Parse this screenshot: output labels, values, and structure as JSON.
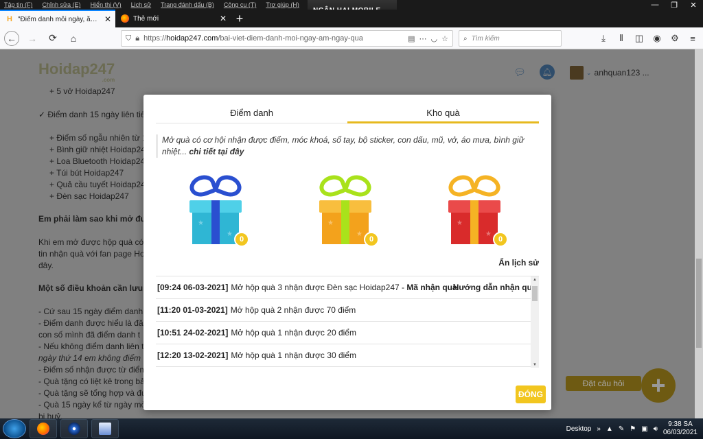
{
  "window": {
    "menus": [
      "Tập tin (F)",
      "Chỉnh sửa (E)",
      "Hiển thị (V)",
      "Lịch sử",
      "Trang đánh dấu (B)",
      "Công cụ (T)",
      "Trợ giúp (H)"
    ],
    "ad_text": "NGÂN HAI MOBILE",
    "minimize": "—",
    "restore": "❐",
    "close": "✕"
  },
  "tabs": [
    {
      "title": "\"Điểm danh mỗi ngày, ẵm ngày quà\"",
      "favicon": "H",
      "close": "✕"
    },
    {
      "title": "Thẻ mới",
      "close": "✕"
    }
  ],
  "new_tab": "+",
  "nav": {
    "url_prefix": "https://",
    "url_domain": "hoidap247.com",
    "url_path": "/bai-viet-diem-danh-moi-ngay-am-ngay-qua",
    "search_placeholder": "Tìm kiếm"
  },
  "site": {
    "logo": "Hoidap247",
    "logo_domain": ".com",
    "username": "anhquan123 ..."
  },
  "article": [
    "+ 5 vở Hoidap247",
    "✓ Điểm danh 15 ngày liên tiế",
    "+ Điểm số ngẫu nhiên từ 1",
    "+ Bình giữ nhiệt Hoidap24",
    "+ Loa Bluetooth Hoidap24",
    "+ Túi bút Hoidap247",
    "+ Quả cầu tuyết Hoidap24",
    "+ Đèn sạc Hoidap247",
    "Em phải làm sao khi mở đư",
    "Khi em mở được hộp quà có",
    "tin nhận quà với fan page Ho",
    "đây.",
    "Một số điều khoản cần lưu",
    "- Cứ sau 15 ngày điểm danh,",
    "- Điểm danh được hiểu là đă",
    "con số mình đã điểm danh t",
    "- Nếu không điểm danh liên t",
    "ngày thứ 14 em không điểm",
    "- Điểm số nhận được từ điểm",
    "- Quà tặng có liệt kê trong bả",
    "- Quà tặng sẽ tổng hợp và đư",
    "- Quà 15 ngày kể từ ngày mở",
    "bị huỷ."
  ],
  "ask": {
    "label": "Đặt câu hỏi",
    "plus": "+"
  },
  "modal": {
    "tab_checkin": "Điểm danh",
    "tab_gifts": "Kho quà",
    "intro": "Mở quà có cơ hội nhận được điểm, móc khoá, sổ tay, bộ sticker, con dấu, mũ, vở, áo mưa, bình giữ nhiệt...",
    "intro_link": "chi tiết tại đây",
    "gifts": [
      {
        "count": "0",
        "color": "#2fb6d4",
        "ribbon": "#2a4fd0"
      },
      {
        "count": "0",
        "color": "#f3a21c",
        "ribbon": "#a9e21b"
      },
      {
        "count": "0",
        "color": "#d92b2b",
        "ribbon": "#f5b324"
      }
    ],
    "hide_history": "Ẩn lịch sử",
    "history": [
      {
        "time": "[09:24 06-03-2021]",
        "text": "Mở hộp quà 3 nhận được Đèn sạc Hoidap247 -",
        "extra": "Mã nhận quà",
        "guide": "Hướng dẫn nhận quà"
      },
      {
        "time": "[11:20 01-03-2021]",
        "text": "Mở hộp quà 2 nhận được 70 điểm"
      },
      {
        "time": "[10:51 24-02-2021]",
        "text": "Mở hộp quà 1 nhận được 20 điểm"
      },
      {
        "time": "[12:20 13-02-2021]",
        "text": "Mở hộp quà 1 nhận được 30 điểm"
      }
    ],
    "close_label": "ĐÓNG"
  },
  "taskbar": {
    "desktop_label": "Desktop",
    "time": "9:38 SA",
    "date": "06/03/2021"
  }
}
